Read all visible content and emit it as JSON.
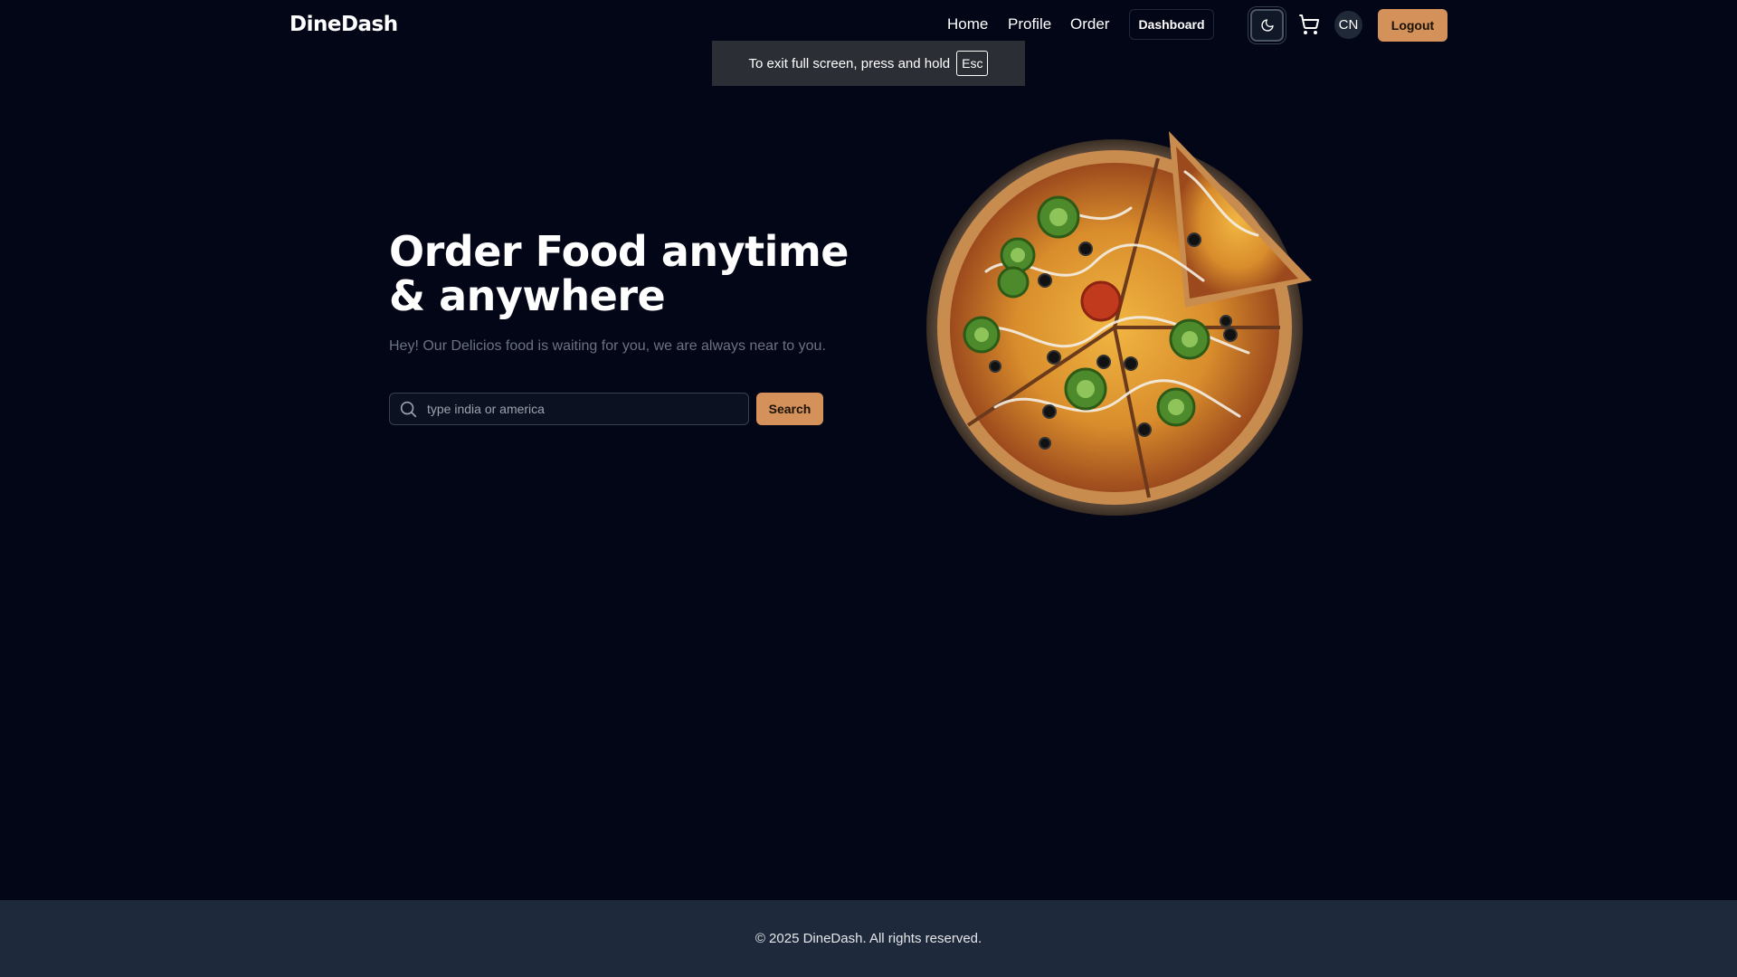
{
  "brand": {
    "name": "DineDash"
  },
  "nav": {
    "links": [
      "Home",
      "Profile",
      "Order"
    ],
    "dashboard_label": "Dashboard",
    "avatar_initials": "CN",
    "logout_label": "Logout"
  },
  "fullscreen_toast": {
    "message": "To exit full screen, press and hold",
    "key": "Esc"
  },
  "hero": {
    "title_line1": "Order Food anytime",
    "title_line2": "& anywhere",
    "subtitle": "Hey! Our Delicios food is waiting for you, we are always near to you.",
    "search_placeholder": "type india or america",
    "search_value": "",
    "search_button": "Search",
    "image": "pizza-image"
  },
  "footer": {
    "text": "© 2025 DineDash. All rights reserved."
  },
  "icons": {
    "theme": "moon-icon",
    "cart": "shopping-cart-icon",
    "search": "search-icon"
  },
  "colors": {
    "background": "#030617",
    "accent": "#d4915a",
    "footer": "#1e293b",
    "muted_text": "#6b7280"
  }
}
